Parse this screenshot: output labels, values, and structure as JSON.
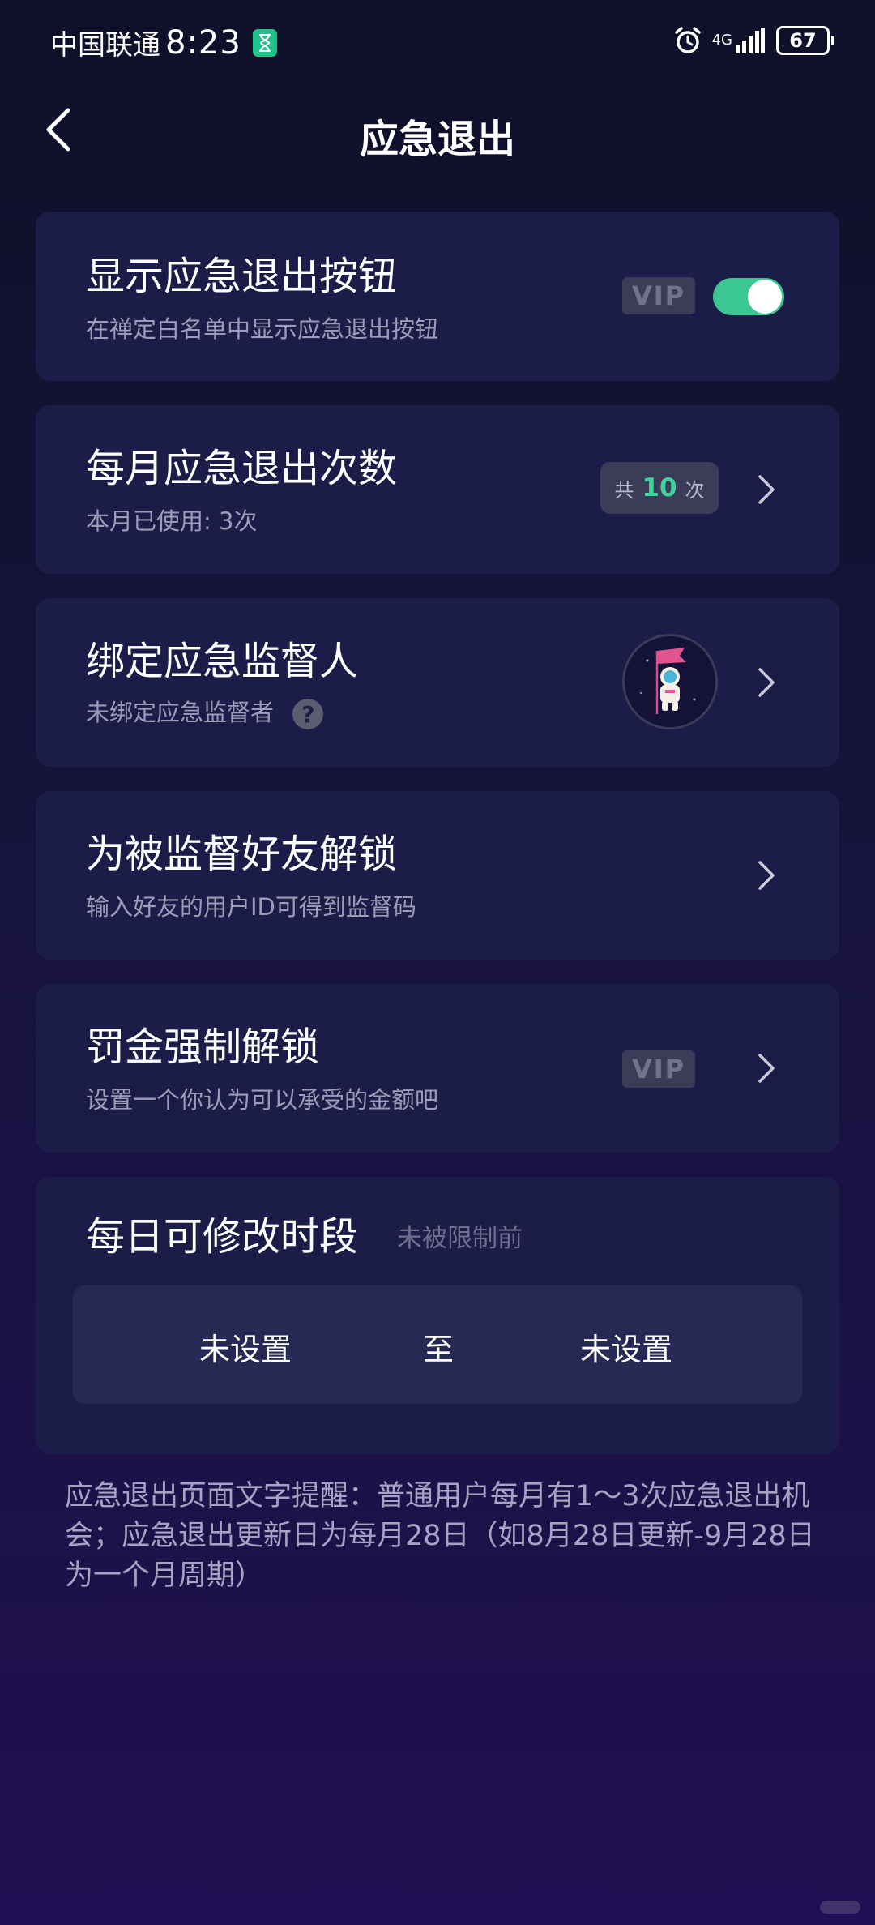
{
  "status_bar": {
    "carrier": "中国联通",
    "time": "8:23",
    "network": "4G",
    "battery": "67"
  },
  "header": {
    "title": "应急退出"
  },
  "items": [
    {
      "title": "显示应急退出按钮",
      "subtitle": "在禅定白名单中显示应急退出按钮",
      "vip": "VIP",
      "toggle_on": true
    },
    {
      "title": "每月应急退出次数",
      "subtitle": "本月已使用: 3次",
      "badge_prefix": "共",
      "badge_count": "10",
      "badge_suffix": "次"
    },
    {
      "title": "绑定应急监督人",
      "subtitle": "未绑定应急监督者",
      "help": "?"
    },
    {
      "title": "为被监督好友解锁",
      "subtitle": "输入好友的用户ID可得到监督码"
    },
    {
      "title": "罚金强制解锁",
      "subtitle": "设置一个你认为可以承受的金额吧",
      "vip": "VIP"
    }
  ],
  "schedule": {
    "title": "每日可修改时段",
    "hint": "未被限制前",
    "start": "未设置",
    "separator": "至",
    "end": "未设置"
  },
  "note": "应急退出页面文字提醒：普通用户每月有1～3次应急退出机会；应急退出更新日为每月28日（如8月28日更新-9月28日为一个月周期）",
  "colors": {
    "accent_green": "#3cc691",
    "card_bg": "#1c1c48"
  }
}
